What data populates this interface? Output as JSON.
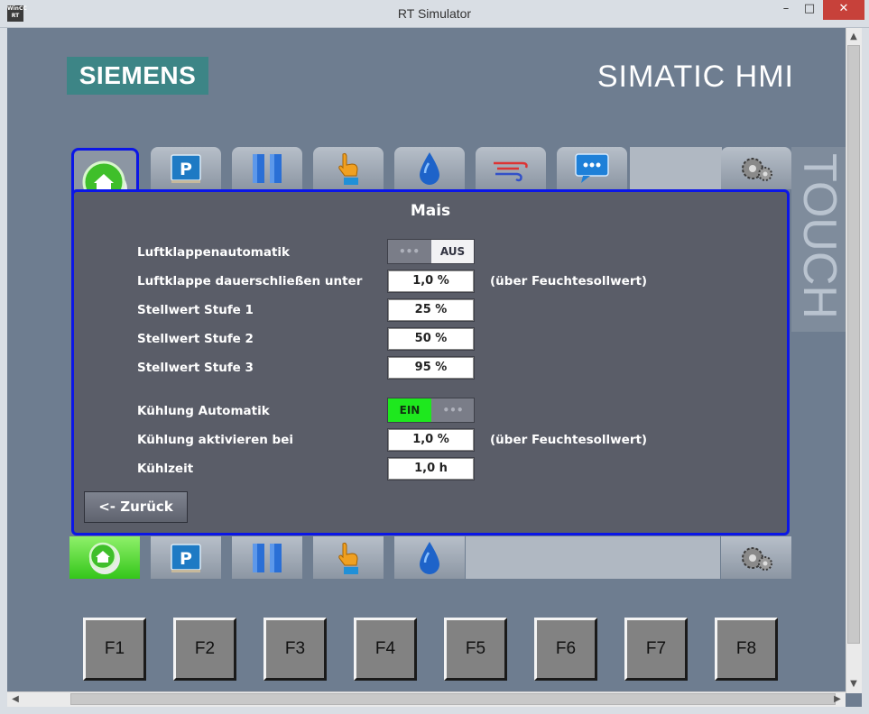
{
  "window": {
    "app_icon_text": "WinCC RT",
    "title": "RT Simulator",
    "minimize": "–",
    "maximize": "□",
    "close": "✕"
  },
  "branding": {
    "logo": "SIEMENS",
    "product": "SIMATIC HMI",
    "side_label": "TOUCH"
  },
  "nav_tabs": {
    "top": [
      "home-icon",
      "parameter-icon",
      "pause-icon",
      "hand-icon",
      "water-drop-icon",
      "airflow-icon",
      "message-icon",
      "settings-gear-icon"
    ],
    "parameter_letter": "P"
  },
  "panel": {
    "title": "Mais",
    "rows": {
      "luftklappenautomatik": {
        "label": "Luftklappenautomatik",
        "toggle_off": "AUS",
        "toggle_dots": "•••"
      },
      "luftklappe_schliessen": {
        "label": "Luftklappe dauerschließen unter",
        "value": "1,0 %",
        "note": "(über Feuchtesollwert)"
      },
      "stufe1": {
        "label": "Stellwert Stufe 1",
        "value": "25 %"
      },
      "stufe2": {
        "label": "Stellwert Stufe 2",
        "value": "50 %"
      },
      "stufe3": {
        "label": "Stellwert Stufe 3",
        "value": "95 %"
      },
      "kuehlung_automatik": {
        "label": "Kühlung Automatik",
        "toggle_on": "EIN",
        "toggle_dots": "•••"
      },
      "kuehlung_aktivieren": {
        "label": "Kühlung aktivieren bei",
        "value": "1,0 %",
        "note": "(über Feuchtesollwert)"
      },
      "kuehlzeit": {
        "label": "Kühlzeit",
        "value": "1,0 h"
      }
    },
    "back_button": "<- Zurück"
  },
  "function_keys": [
    "F1",
    "F2",
    "F3",
    "F4",
    "F5",
    "F6",
    "F7",
    "F8"
  ],
  "colors": {
    "panel_border": "#0b16e6",
    "toggle_on": "#1ee81e",
    "brand_teal": "#3d8586",
    "background": "#6e7d90"
  }
}
